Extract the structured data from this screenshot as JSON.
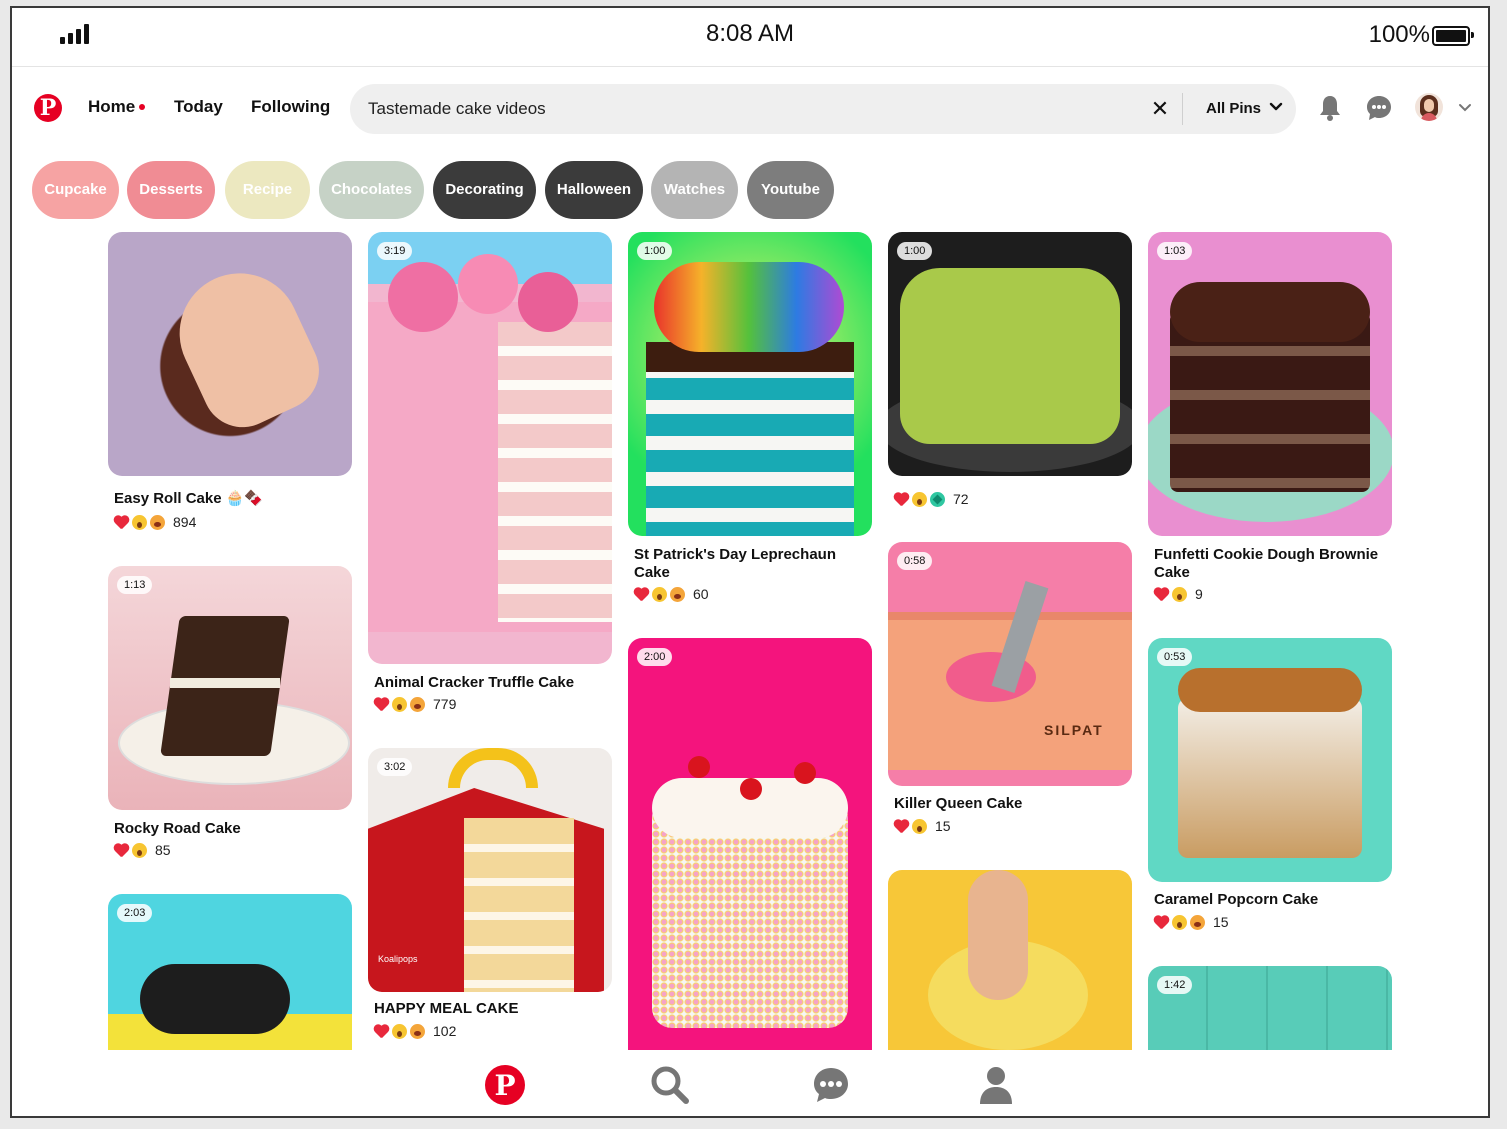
{
  "status_bar": {
    "time": "8:08 AM",
    "battery": "100%"
  },
  "nav": {
    "links": [
      "Home",
      "Today",
      "Following"
    ],
    "search_value": "Tastemade cake videos",
    "filter_label": "All Pins"
  },
  "chips": [
    {
      "label": "Cupcake",
      "color": "#f6a3a3"
    },
    {
      "label": "Desserts",
      "color": "#f08c94"
    },
    {
      "label": "Recipe",
      "color": "#ece8c0"
    },
    {
      "label": "Chocolates",
      "color": "#c6d2c6"
    },
    {
      "label": "Decorating",
      "color": "#3b3b3b"
    },
    {
      "label": "Halloween",
      "color": "#3b3b3b"
    },
    {
      "label": "Watches",
      "color": "#b4b4b4"
    },
    {
      "label": "Youtube",
      "color": "#7d7d7d"
    }
  ],
  "pins": [
    {
      "title": "Easy Roll Cake 🧁🍫",
      "reactions": [
        "heart",
        "wow",
        "face"
      ],
      "count": "894"
    },
    {
      "duration": "1:13",
      "title": "Rocky Road Cake",
      "reactions": [
        "heart",
        "wow"
      ],
      "count": "85"
    },
    {
      "duration": "2:03"
    },
    {
      "duration": "3:19",
      "title": "Animal Cracker Truffle Cake",
      "reactions": [
        "heart",
        "wow",
        "face"
      ],
      "count": "779"
    },
    {
      "duration": "3:02",
      "title": "HAPPY MEAL CAKE",
      "reactions": [
        "heart",
        "wow",
        "face"
      ],
      "count": "102",
      "watermark": "Koalipops"
    },
    {
      "duration": "1:00",
      "title": "St Patrick's Day Leprechaun Cake",
      "reactions": [
        "heart",
        "wow",
        "face"
      ],
      "count": "60"
    },
    {
      "duration": "2:00"
    },
    {
      "duration": "1:00",
      "reactions": [
        "heart",
        "wow",
        "star"
      ],
      "count": "72"
    },
    {
      "duration": "0:58",
      "title": "Killer Queen Cake",
      "reactions": [
        "heart",
        "wow"
      ],
      "count": "15",
      "mat_text": "SILPAT"
    },
    {},
    {
      "duration": "1:03",
      "title": "Funfetti Cookie Dough Brownie Cake",
      "reactions": [
        "heart",
        "wow"
      ],
      "count": "9"
    },
    {
      "duration": "0:53",
      "title": "Caramel Popcorn Cake",
      "reactions": [
        "heart",
        "wow",
        "face"
      ],
      "count": "15"
    },
    {
      "duration": "1:42"
    }
  ],
  "colors": {
    "brand": "#e60023"
  }
}
